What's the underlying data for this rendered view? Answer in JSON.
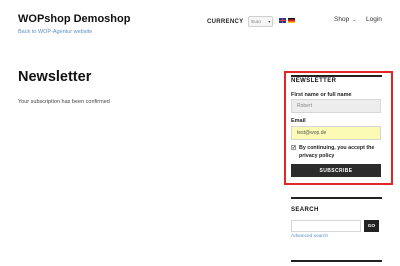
{
  "header": {
    "site_title": "WOPshop Demoshop",
    "tagline": "Back to WOP-Agentur website",
    "currency_label": "CURRENCY",
    "currency_value": "Euro",
    "languages": [
      "en-flag-icon",
      "de-flag-icon"
    ],
    "nav": {
      "shop": "Shop",
      "login": "Login"
    }
  },
  "main": {
    "title": "Newsletter",
    "message": "Your subscription has been confirmed"
  },
  "newsletter_widget": {
    "title": "NEWSLETTER",
    "name_label": "First name or full name",
    "name_value": "Robert",
    "email_label": "Email",
    "email_value": "test@wop.de",
    "consent_checked": true,
    "consent_text": "By continuing, you accept the privacy policy",
    "subscribe_label": "SUBSCRIBE",
    "highlight_color": "#e32626"
  },
  "search_widget": {
    "title": "SEARCH",
    "input_value": "",
    "button_label": "GO",
    "advanced_link": "Advanced search"
  }
}
